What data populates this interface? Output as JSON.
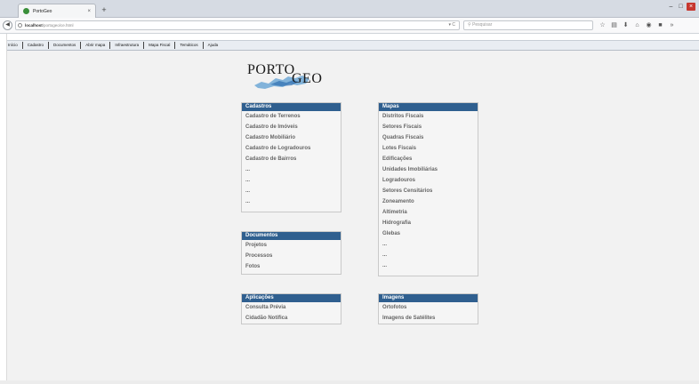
{
  "browser": {
    "tab_title": "PortoGeo",
    "tab_close": "×",
    "new_tab": "+",
    "url_host": "localhost",
    "url_path": "/portogeo/ce.html",
    "reload": "▾ C",
    "search_placeholder": "Pesquisar",
    "window_controls": [
      "‒",
      "□",
      "×"
    ],
    "toolbar_icons": [
      "star-icon",
      "library-icon",
      "download-icon",
      "home-icon",
      "pocket-icon",
      "screenshot-icon",
      "more-icon"
    ]
  },
  "app_menu": {
    "items": [
      "Início",
      "Cadastro",
      "Documentos",
      "Abrir mapa",
      "Infraestrutura",
      "Mapa Fiscal",
      "Temáticos",
      "Ajuda"
    ]
  },
  "logo": {
    "word1": "PORTO",
    "word2": "GEO"
  },
  "panels": {
    "cadastros": {
      "title": "Cadastros",
      "items": [
        "Cadastro de Terrenos",
        "Cadastro de Imóveis",
        "Cadastro Mobiliário",
        "Cadastro de Logradouros",
        "Cadastro de Bairros",
        "...",
        "...",
        "...",
        "..."
      ]
    },
    "mapas": {
      "title": "Mapas",
      "items": [
        "Distritos Fiscais",
        "Setores Fiscais",
        "Quadras Fiscais",
        "Lotes Fiscais",
        "Edificações",
        "Unidades Imobiliárias",
        "Logradouros",
        "Setores Censitários",
        "Zoneamento",
        "Altimetria",
        "Hidrografia",
        "Glebas",
        "...",
        "...",
        "..."
      ]
    },
    "documentos": {
      "title": "Documentos",
      "items": [
        "Projetos",
        "Processos",
        "Fotos"
      ]
    },
    "aplicacoes": {
      "title": "Aplicações",
      "items": [
        "Consulta Prévia",
        "Cidadão Notifica"
      ]
    },
    "imagens": {
      "title": "Imagens",
      "items": [
        "Ortofotos",
        "Imagens de Satélites"
      ]
    }
  },
  "colors": {
    "panel_header": "#2f5f8f",
    "item_text": "#666666",
    "background": "#f2f2f2"
  }
}
